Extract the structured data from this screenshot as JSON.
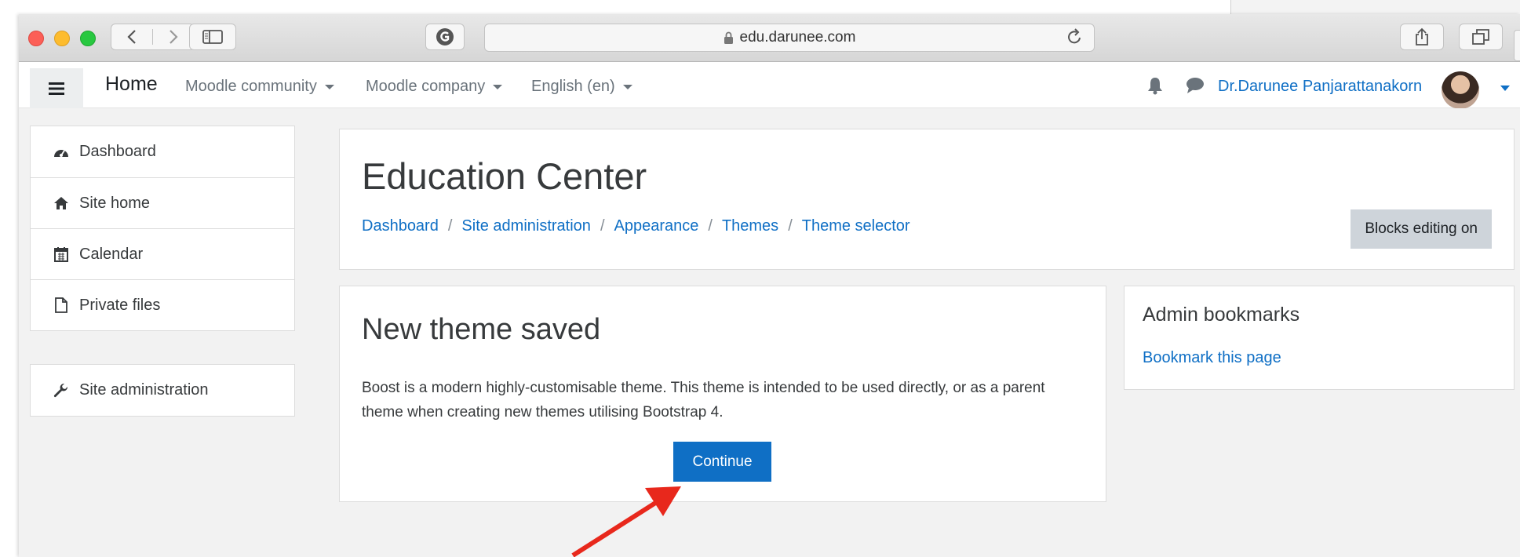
{
  "browser": {
    "url": "edu.darunee.com",
    "icons": [
      "back-icon",
      "forward-icon",
      "sidebar-icon",
      "grammarly-icon",
      "lock-icon",
      "reload-icon",
      "share-icon",
      "tabs-icon",
      "new-tab-icon"
    ]
  },
  "navbar": {
    "home": "Home",
    "menus": [
      "Moodle community",
      "Moodle company",
      "English (en)"
    ],
    "user_name": "Dr.Darunee Panjarattanakorn"
  },
  "drawer": {
    "items": [
      "Dashboard",
      "Site home",
      "Calendar",
      "Private files"
    ],
    "admin_item": "Site administration"
  },
  "header": {
    "title": "Education Center",
    "breadcrumbs": [
      "Dashboard",
      "Site administration",
      "Appearance",
      "Themes",
      "Theme selector"
    ],
    "separator": "/",
    "blocks_button": "Blocks editing on"
  },
  "content": {
    "title": "New theme saved",
    "description": "Boost is a modern highly-customisable theme. This theme is intended to be used directly, or as a parent theme when creating new themes utilising Bootstrap 4.",
    "continue_label": "Continue"
  },
  "bookmarks": {
    "title": "Admin bookmarks",
    "link": "Bookmark this page"
  },
  "colors": {
    "link": "#0f6fc5",
    "primary_button": "#0f6fc5",
    "secondary_button": "#ced4da",
    "page_bg": "#f2f2f2",
    "annotation_arrow": "#e8281c"
  }
}
